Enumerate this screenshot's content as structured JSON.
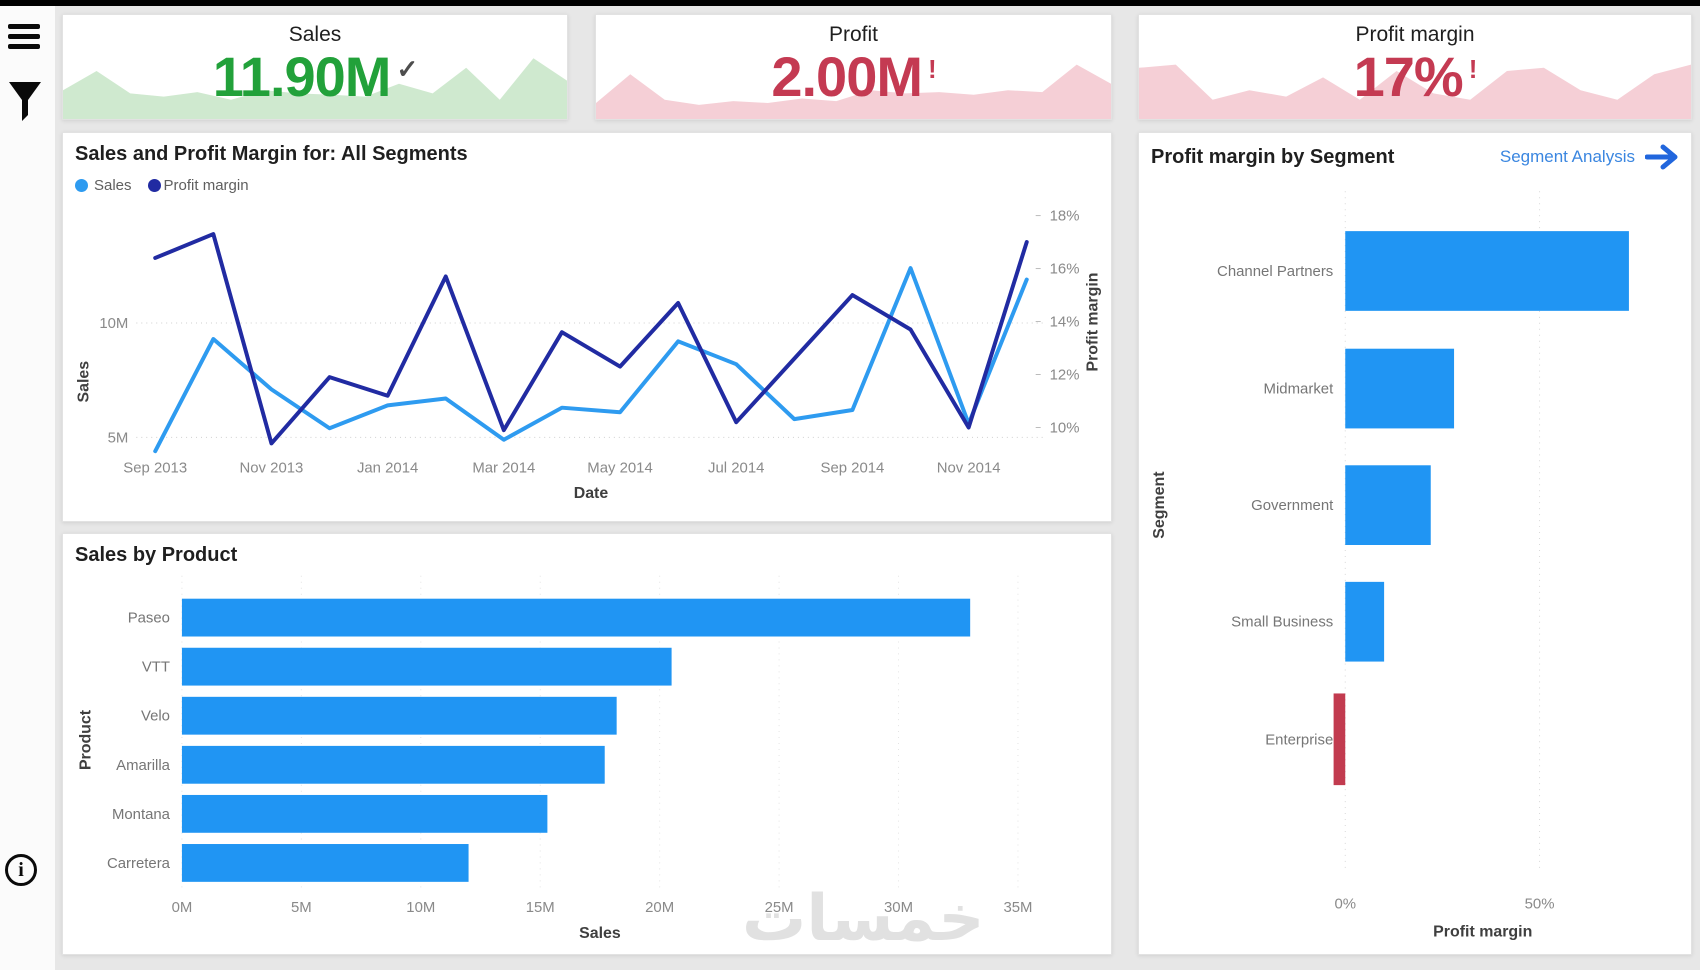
{
  "page": {
    "background": "#e7e7e7",
    "top_bar_color": "#000000",
    "watermark": "خمسات"
  },
  "sidebar": {
    "icons": [
      {
        "name": "menu-icon"
      },
      {
        "name": "filter-icon"
      },
      {
        "name": "info-icon",
        "glyph": "i"
      }
    ]
  },
  "kpi_cards": [
    {
      "title": "Sales",
      "value": "11.90M",
      "value_color": "#22a13a",
      "status_icon": "check-icon",
      "status_glyph": "✓",
      "status_color": "#4d4d4d",
      "spark_fill": "#cfe9cf",
      "spark_values": [
        0.45,
        0.75,
        0.4,
        0.35,
        0.42,
        0.3,
        0.45,
        0.4,
        0.38,
        0.35,
        0.55,
        0.4,
        0.8,
        0.3,
        0.95,
        0.6
      ]
    },
    {
      "title": "Profit",
      "value": "2.00M",
      "value_color": "#c43a52",
      "status_icon": "alert-icon",
      "status_glyph": "!",
      "status_color": "#c43a52",
      "spark_fill": "#f5cfd6",
      "spark_values": [
        0.25,
        0.7,
        0.3,
        0.22,
        0.28,
        0.25,
        0.32,
        0.28,
        0.45,
        0.4,
        0.42,
        0.38,
        0.45,
        0.42,
        0.85,
        0.55
      ]
    },
    {
      "title": "Profit margin",
      "value": "17%",
      "value_color": "#c43a52",
      "status_icon": "alert-icon",
      "status_glyph": "!",
      "status_color": "#c43a52",
      "spark_fill": "#f5cfd6",
      "spark_values": [
        0.8,
        0.85,
        0.3,
        0.45,
        0.35,
        0.65,
        0.3,
        0.75,
        0.4,
        0.3,
        0.75,
        0.8,
        0.45,
        0.3,
        0.7,
        0.85
      ]
    }
  ],
  "chart_data": [
    {
      "id": "sales-margin-line",
      "type": "line",
      "title": "Sales and Profit Margin for: All Segments",
      "xlabel": "Date",
      "x": [
        "Sep 2013",
        "Oct 2013",
        "Nov 2013",
        "Dec 2013",
        "Jan 2014",
        "Feb 2014",
        "Mar 2014",
        "Apr 2014",
        "May 2014",
        "Jun 2014",
        "Jul 2014",
        "Aug 2014",
        "Sep 2014",
        "Oct 2014",
        "Nov 2014",
        "Dec 2014"
      ],
      "x_tick_labels": [
        "Sep 2013",
        "Nov 2013",
        "Jan 2014",
        "Mar 2014",
        "May 2014",
        "Jul 2014",
        "Sep 2014",
        "Nov 2014"
      ],
      "series": [
        {
          "name": "Sales",
          "color": "#2e9bf0",
          "axis": "left",
          "values_M": [
            4.4,
            9.3,
            7.1,
            5.4,
            6.4,
            6.7,
            4.9,
            6.3,
            6.1,
            9.2,
            8.2,
            5.8,
            6.2,
            12.4,
            5.6,
            11.9
          ]
        },
        {
          "name": "Profit margin",
          "color": "#212ba2",
          "axis": "right",
          "values_pct": [
            16.4,
            17.3,
            9.4,
            11.9,
            11.2,
            15.7,
            9.9,
            13.6,
            12.3,
            14.7,
            10.2,
            12.6,
            15.0,
            13.7,
            10.0,
            17.0
          ]
        }
      ],
      "left_axis": {
        "label": "Sales",
        "ticks": [
          "5M",
          "10M"
        ],
        "tick_values_M": [
          5,
          10
        ]
      },
      "right_axis": {
        "label": "Profit margin",
        "ticks": [
          "18%",
          "16%",
          "14%",
          "12%",
          "10%"
        ],
        "tick_values_pct": [
          18,
          16,
          14,
          12,
          10
        ]
      },
      "grid": "dotted-horizontal",
      "legend_position": "top-left"
    },
    {
      "id": "sales-by-product",
      "type": "bar",
      "title": "Sales by Product",
      "xlabel": "Sales",
      "ylabel": "Product",
      "categories": [
        "Paseo",
        "VTT",
        "Velo",
        "Amarilla",
        "Montana",
        "Carretera"
      ],
      "values_M": [
        33.0,
        20.5,
        18.2,
        17.7,
        15.3,
        12.0
      ],
      "bar_color": "#2095f3",
      "x_ticks": [
        "0M",
        "5M",
        "10M",
        "15M",
        "20M",
        "25M",
        "30M",
        "35M"
      ],
      "x_tick_values_M": [
        0,
        5,
        10,
        15,
        20,
        25,
        30,
        35
      ],
      "xlim_M": [
        0,
        35
      ]
    },
    {
      "id": "profit-margin-by-segment",
      "type": "bar",
      "title": "Profit margin by Segment",
      "link_label": "Segment Analysis",
      "link_color": "#3a86e0",
      "arrow_color": "#2166dd",
      "xlabel": "Profit margin",
      "ylabel": "Segment",
      "categories": [
        "Channel Partners",
        "Midmarket",
        "Government",
        "Small Business",
        "Enterprise"
      ],
      "values_pct": [
        73,
        28,
        22,
        10,
        -3
      ],
      "bar_colors": [
        "#2095f3",
        "#2095f3",
        "#2095f3",
        "#2095f3",
        "#c23b4f"
      ],
      "x_ticks": [
        "0%",
        "50%"
      ],
      "x_tick_values_pct": [
        0,
        50
      ]
    }
  ]
}
